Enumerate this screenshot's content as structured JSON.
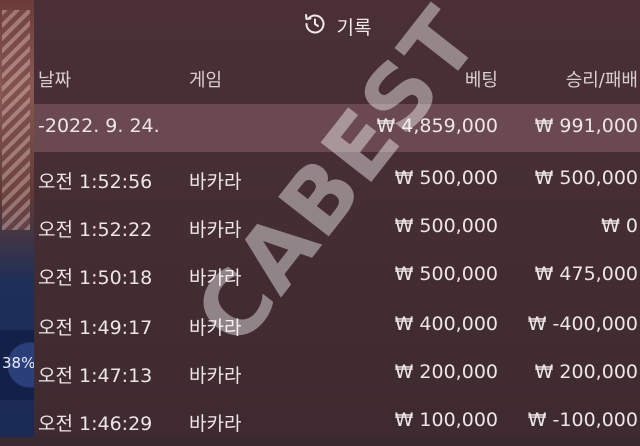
{
  "header": {
    "title": "기록",
    "icon": "history-icon"
  },
  "columns": {
    "date": "날짜",
    "game": "게임",
    "bet": "베팅",
    "result": "승리/패배"
  },
  "summary": {
    "date": "-2022. 9. 24.",
    "bet": "₩ 4,859,000",
    "result": "₩ 991,000"
  },
  "rows": [
    {
      "time": "오전 1:52:56",
      "game": "바카라",
      "bet": "₩ 500,000",
      "result": "₩ 500,000"
    },
    {
      "time": "오전 1:52:22",
      "game": "바카라",
      "bet": "₩ 500,000",
      "result": "₩ 0"
    },
    {
      "time": "오전 1:50:18",
      "game": "바카라",
      "bet": "₩ 500,000",
      "result": "₩ 475,000"
    },
    {
      "time": "오전 1:49:17",
      "game": "바카라",
      "bet": "₩ 400,000",
      "result": "₩ -400,000"
    },
    {
      "time": "오전 1:47:13",
      "game": "바카라",
      "bet": "₩ 200,000",
      "result": "₩ 200,000"
    },
    {
      "time": "오전 1:46:29",
      "game": "바카라",
      "bet": "₩ 100,000",
      "result": "₩ -100,000"
    }
  ],
  "side": {
    "progress_text": "38%"
  },
  "watermark": "CABEST",
  "colors": {
    "panel": "#4a3036",
    "summary_row": "#6a4a50",
    "text": "#ece6e7"
  }
}
